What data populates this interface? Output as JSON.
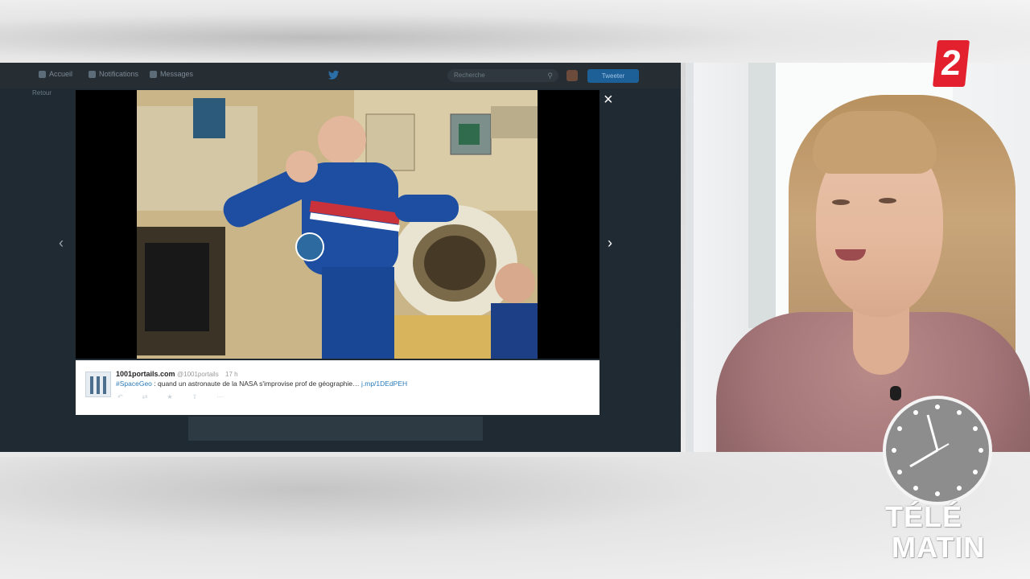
{
  "twitter": {
    "nav": [
      "Accueil",
      "Notifications",
      "Messages"
    ],
    "search_placeholder": "Recherche",
    "tweet_button": "Tweeter",
    "sub_label": "Retour"
  },
  "lightbox": {
    "close_label": "×",
    "prev_label": "‹",
    "next_label": "›"
  },
  "tweet": {
    "name": "1001portails.com",
    "handle": "@1001portails",
    "time": "17 h",
    "hashtag": "#SpaceGeo",
    "text": " : quand un astronaute de la NASA s'improvise prof de géographie… ",
    "link": "j.mp/1DEdPEH",
    "actions": [
      "↶",
      "⇄",
      "★",
      "⇧",
      "⋯"
    ]
  },
  "broadcast": {
    "channel_number": "2",
    "watermark_line1": "TÉLÉ",
    "watermark_line2": "MATIN"
  },
  "colors": {
    "channel_red": "#e3202d",
    "twitter_link": "#2b7bb9",
    "twitter_dark": "#202a33"
  }
}
